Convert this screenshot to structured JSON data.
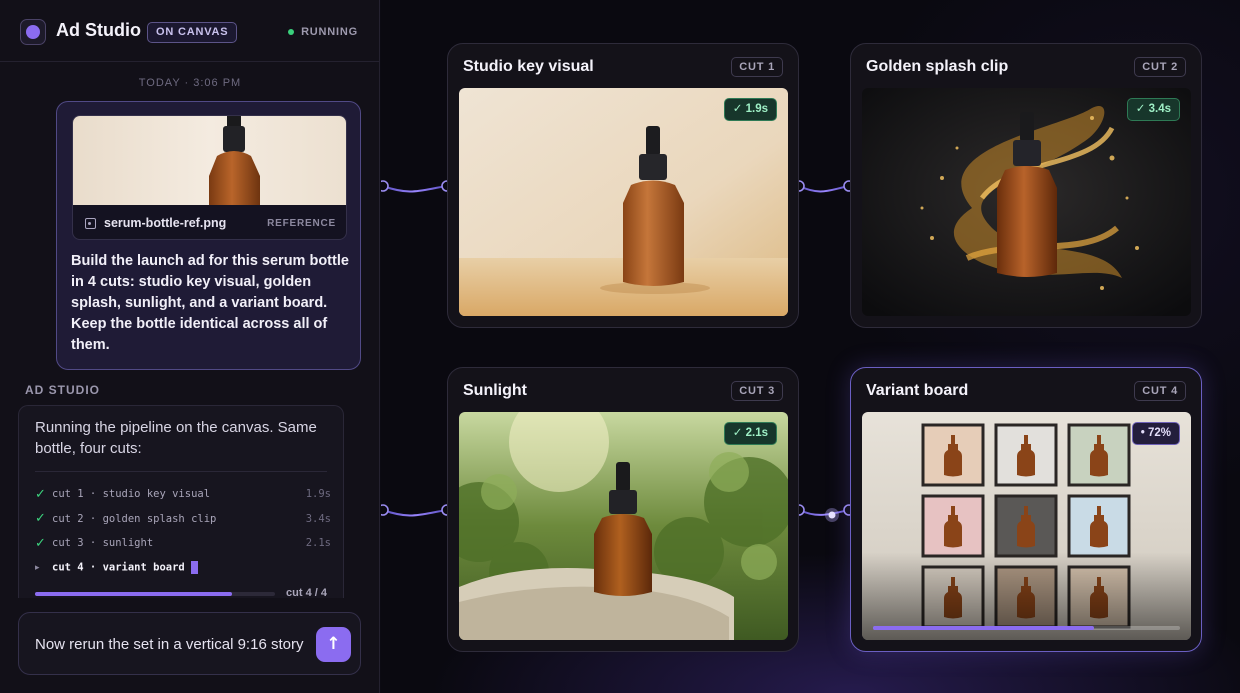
{
  "app": {
    "title": "Ad Studio",
    "mode_badge": "ON CANVAS",
    "status": "RUNNING"
  },
  "thread": {
    "timestamp": "TODAY · 3:06 PM",
    "user_message": {
      "attachment": {
        "file_name": "serum-bottle-ref.png",
        "tag": "REFERENCE"
      },
      "text": "Build the launch ad for this serum bottle in 4 cuts: studio key visual, golden splash, sunlight, and a variant board. Keep the bottle identical across all of them."
    },
    "assistant": {
      "sender": "AD STUDIO",
      "text": "Running the pipeline on the canvas. Same bottle, four cuts:",
      "steps": [
        {
          "status": "✓",
          "label": "cut 1 · studio key visual",
          "time": "1.9s"
        },
        {
          "status": "✓",
          "label": "cut 2 · golden splash clip",
          "time": "3.4s"
        },
        {
          "status": "✓",
          "label": "cut 3 · sunlight",
          "time": "2.1s"
        },
        {
          "status": "▸",
          "label": "cut 4 · variant board",
          "time": ""
        }
      ],
      "progress": {
        "label": "cut 4 / 4",
        "fraction": 0.82
      }
    }
  },
  "composer": {
    "value": "Now rerun the set in a vertical 9:16 story",
    "send_icon": "↑"
  },
  "canvas": {
    "nodes": [
      {
        "title": "Studio key visual",
        "cut": "CUT 1",
        "badge": "✓ 1.9s"
      },
      {
        "title": "Golden splash clip",
        "cut": "CUT 2",
        "badge": "✓ 3.4s"
      },
      {
        "title": "Sunlight",
        "cut": "CUT 3",
        "badge": "✓ 2.1s"
      },
      {
        "title": "Variant board",
        "cut": "CUT 4",
        "badge": "• 72%",
        "progress": 0.72
      }
    ]
  },
  "colors": {
    "accent": "#8b6cf0",
    "success": "#3ad07c",
    "amber_bottle": "#a0501c"
  }
}
